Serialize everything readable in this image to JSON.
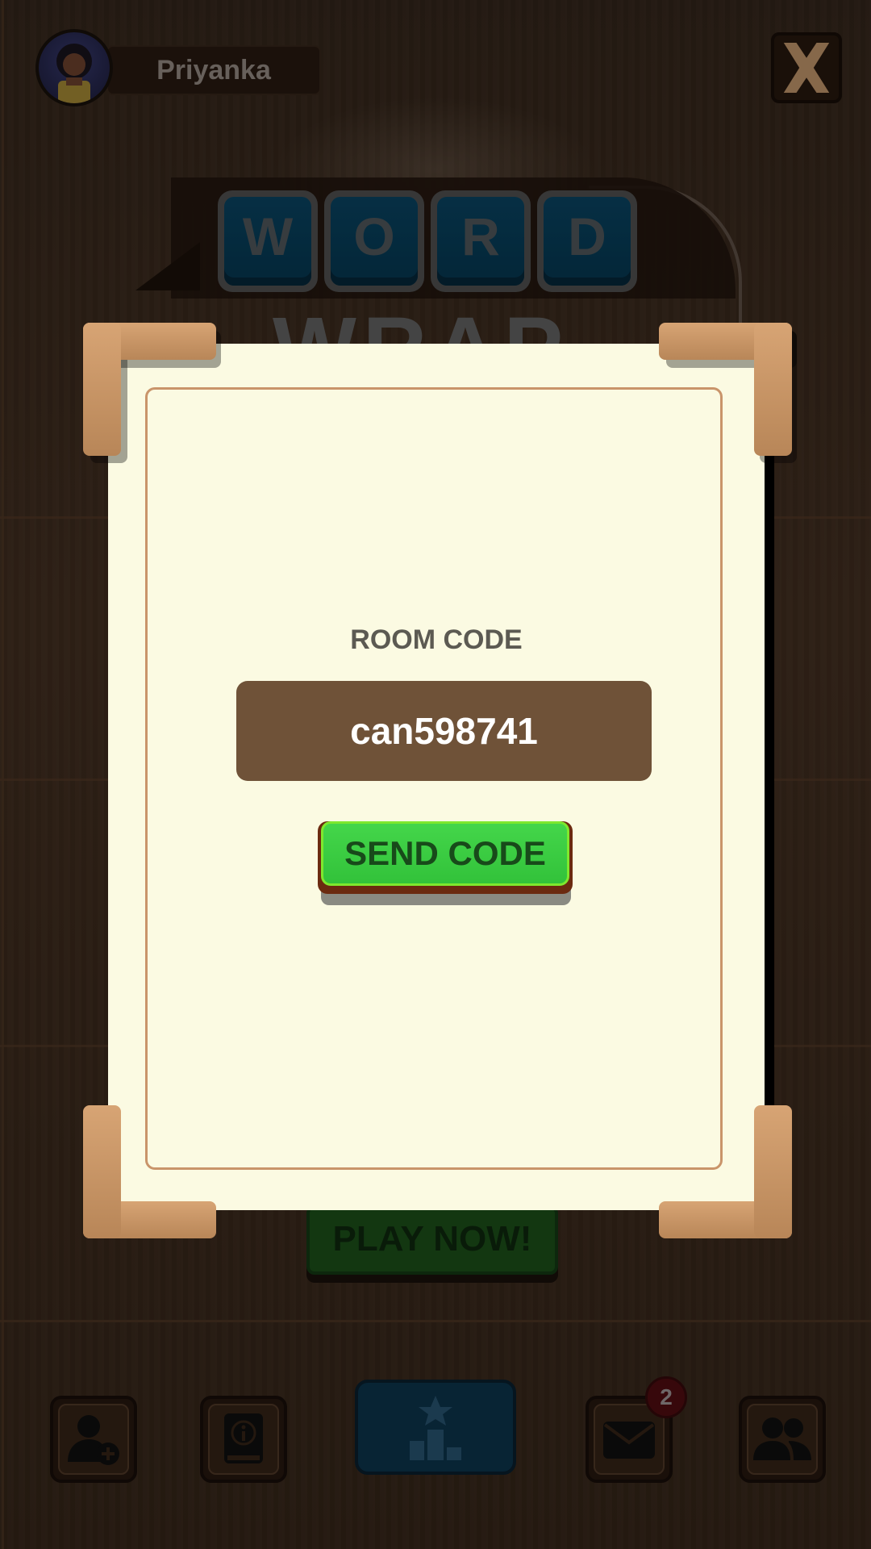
{
  "profile": {
    "name": "Priyanka",
    "avatar_icon": "user-avatar-icon"
  },
  "header": {
    "close_icon": "close-x-icon"
  },
  "logo": {
    "letters": [
      "W",
      "O",
      "R",
      "D"
    ],
    "subtitle": "WRAP"
  },
  "play": {
    "label": "PLAY NOW!"
  },
  "modal": {
    "room_code_label": "ROOM CODE",
    "room_code_value": "can598741",
    "send_button_label": "SEND CODE"
  },
  "bottom_nav": {
    "items": [
      {
        "icon": "add-friend-icon"
      },
      {
        "icon": "info-book-icon"
      },
      {
        "icon": "leaderboard-icon"
      },
      {
        "icon": "mail-icon",
        "badge": "2"
      },
      {
        "icon": "friends-icon"
      }
    ]
  },
  "colors": {
    "modal_bg": "#fbfae2",
    "code_box": "#6f5238",
    "send_button": "#32c23a",
    "corner": "#c99566"
  }
}
